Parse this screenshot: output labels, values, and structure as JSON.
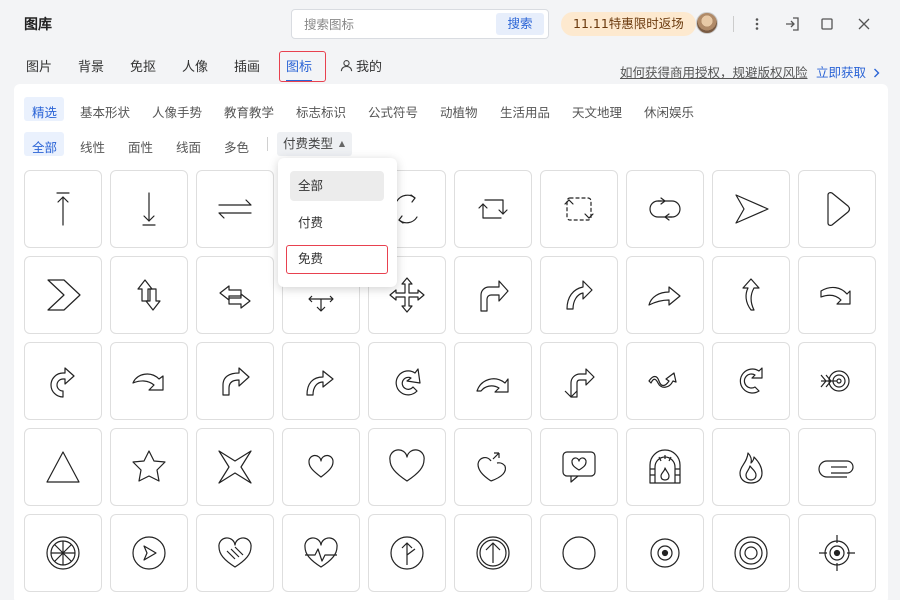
{
  "app": {
    "title": "图库"
  },
  "search": {
    "placeholder": "搜索图标",
    "button_label": "搜索"
  },
  "promo": {
    "label": "11.11特惠限时返场"
  },
  "window_controls": {
    "more_icon": "more-vertical-icon",
    "exit_icon": "exit-icon",
    "maximize_icon": "maximize-icon",
    "close_icon": "close-icon"
  },
  "main_tabs": [
    {
      "label": "图片"
    },
    {
      "label": "背景"
    },
    {
      "label": "免抠"
    },
    {
      "label": "人像"
    },
    {
      "label": "插画"
    },
    {
      "label": "图标",
      "active": true
    },
    {
      "label": "我的",
      "icon": "user-icon"
    }
  ],
  "license": {
    "question": "如何获得商用授权，规避版权风险",
    "get_label": "立即获取"
  },
  "categories": [
    "精选",
    "基本形状",
    "人像手势",
    "教育教学",
    "标志标识",
    "公式符号",
    "动植物",
    "生活用品",
    "天文地理",
    "休闲娱乐"
  ],
  "active_category": "精选",
  "sub_filters": [
    "全部",
    "线性",
    "面性",
    "线面",
    "多色"
  ],
  "active_sub_filter": "全部",
  "pay_type": {
    "label": "付费类型"
  },
  "pay_dropdown": {
    "options": [
      "全部",
      "付费",
      "免费"
    ],
    "selected": "全部",
    "highlighted": "免费"
  },
  "icons": [
    "arrow-up-bar-icon",
    "arrow-down-bar-icon",
    "swap-horizontal-icon",
    "refresh-circle-icon",
    "repeat-square-icon",
    "repeat-dashed-icon",
    "loop-icon",
    "send-triangle-icon",
    "rounded-triangle-right-icon",
    "chevron-right-outline-icon",
    "updown-outline-arrow-icon",
    "leftright-outline-arrow-icon",
    "four-way-arrow-icon",
    "four-way-move-icon",
    "turn-right-arrow-icon",
    "curved-arrow-up-right-icon",
    "curved-arrow-right-icon",
    "curved-arrow-up-icon",
    "curved-arrow-down-right-icon",
    "rotate-clockwise-arrow-icon",
    "curved-arrow-down-icon",
    "curved-arrow-right-2-icon",
    "curved-arrow-up-right-2-icon",
    "return-arrow-left-icon",
    "curved-arrow-bend-icon",
    "split-arrow-icon",
    "wave-arrow-icon",
    "cycle-arrow-icon",
    "target-arrow-icon",
    "triangle-icon",
    "star-icon",
    "four-point-star-icon",
    "heart-icon",
    "heart-large-icon",
    "heart-arrow-icon",
    "heart-message-icon",
    "fireplace-icon",
    "flame-icon",
    "paperclip-icon",
    "wheel-icon",
    "play-circle-icon",
    "hand-heart-icon",
    "heartbeat-icon",
    "circle-arrow-up-icon",
    "circle-up-arrow-icon",
    "circle-icon",
    "concentric-circle-icon",
    "bullseye-icon",
    "crosshair-icon"
  ]
}
